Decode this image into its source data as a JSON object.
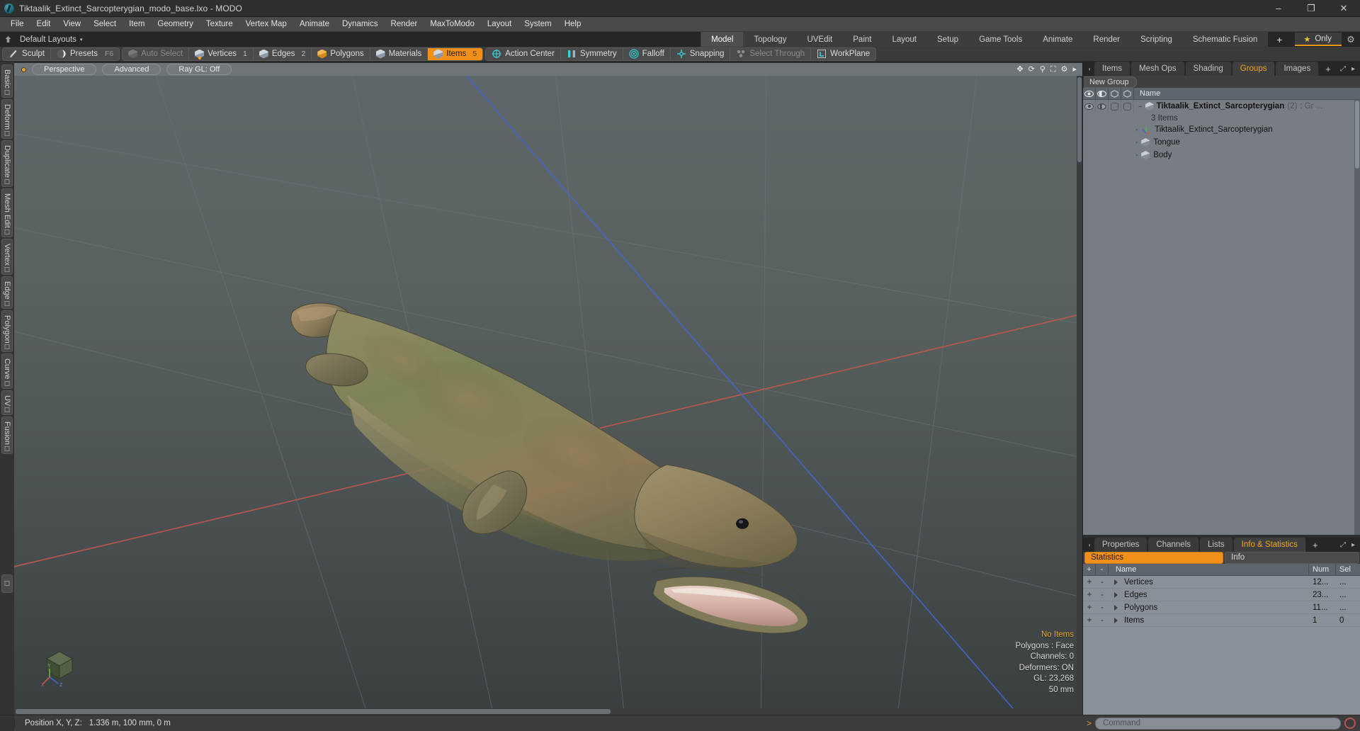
{
  "window": {
    "title": "Tiktaalik_Extinct_Sarcopterygian_modo_base.lxo - MODO",
    "app_icon": "modo-logo-icon",
    "minimize": "–",
    "maximize": "❐",
    "close": "✕"
  },
  "menubar": {
    "items": [
      "File",
      "Edit",
      "View",
      "Select",
      "Item",
      "Geometry",
      "Texture",
      "Vertex Map",
      "Animate",
      "Dynamics",
      "Render",
      "MaxToModo",
      "Layout",
      "System",
      "Help"
    ]
  },
  "layoutbar": {
    "home_icon": "home-arrow-icon",
    "preset_label": "Default Layouts",
    "caret": "▾",
    "tabs": [
      "Model",
      "Topology",
      "UVEdit",
      "Paint",
      "Layout",
      "Setup",
      "Game Tools",
      "Animate",
      "Render",
      "Scripting",
      "Schematic Fusion"
    ],
    "active_tab": "Model",
    "add_tab": "+",
    "only_label": "Only",
    "only_star": "★",
    "gear": "⚙"
  },
  "modebar": {
    "group1": [
      {
        "label": "Sculpt",
        "icon": "brush-icon",
        "state": "normal",
        "shortcut": ""
      },
      {
        "label": "Presets",
        "icon": "sphere-icon",
        "state": "normal",
        "shortcut": "F6"
      }
    ],
    "group2": [
      {
        "label": "Auto Select",
        "icon": "cube-icon",
        "state": "dim",
        "num": ""
      },
      {
        "label": "Vertices",
        "icon": "cube-icon",
        "state": "normal",
        "num": "1"
      },
      {
        "label": "Edges",
        "icon": "cube-icon",
        "state": "normal",
        "num": "2"
      },
      {
        "label": "Polygons",
        "icon": "cube-orange-icon",
        "state": "normal",
        "num": ""
      },
      {
        "label": "Materials",
        "icon": "cube-icon",
        "state": "normal",
        "num": ""
      },
      {
        "label": "Items",
        "icon": "cube-icon",
        "state": "active",
        "num": "5"
      }
    ],
    "group3": [
      {
        "label": "Action Center",
        "icon": "crosshair-circle-icon",
        "state": "normal"
      },
      {
        "label": "Symmetry",
        "icon": "symmetry-bars-icon",
        "state": "normal"
      },
      {
        "label": "Falloff",
        "icon": "concentric-circles-icon",
        "state": "normal"
      },
      {
        "label": "Snapping",
        "icon": "snap-cross-icon",
        "state": "normal"
      },
      {
        "label": "Select Through",
        "icon": "select-through-icon",
        "state": "dim"
      },
      {
        "label": "WorkPlane",
        "icon": "workplane-icon",
        "state": "normal"
      }
    ]
  },
  "left_tool_tabs": [
    "Basic",
    "Deform",
    "Duplicate",
    "Mesh Edit",
    "Vertex",
    "Edge",
    "Polygon",
    "Curve",
    "UV",
    "Fusion"
  ],
  "viewport": {
    "header": {
      "dot": "viewport-active-dot",
      "buttons": [
        "Perspective",
        "Advanced",
        "Ray GL: Off"
      ],
      "icons": [
        "move-icon",
        "rotate-icon",
        "zoom-icon",
        "fit-icon",
        "settings-icon",
        "chevron-right-icon"
      ]
    },
    "overlay": {
      "selection": "No Items",
      "lines": [
        "Polygons : Face",
        "Channels: 0",
        "Deformers: ON",
        "GL: 23,268",
        "50 mm"
      ]
    },
    "axis_labels": {
      "x": "X",
      "y": "Y",
      "z": "Z"
    },
    "model_name": "Tiktaalik 3D fish model"
  },
  "right_panel": {
    "tabs": [
      "Items",
      "Mesh Ops",
      "Shading",
      "Groups",
      "Images"
    ],
    "active_tab": "Groups",
    "add_tab": "+",
    "expand_icon": "expand-icon",
    "overflow_icon": "chevron-right-icon",
    "new_group_label": "New Group",
    "tree_header": {
      "col_icons": [
        "eye-icon",
        "render-eye-icon",
        "wire-cube-icon",
        "wire-cube-icon"
      ],
      "name": "Name"
    },
    "tree": {
      "group": {
        "name": "Tiktaalik_Extinct_Sarcopterygian",
        "count": "(2)",
        "type": ": Gr ...",
        "items_label": "3 Items",
        "icon": "group-cube-icon"
      },
      "children": [
        {
          "name": "Tiktaalik_Extinct_Sarcopterygian",
          "icon": "locator-axis-icon"
        },
        {
          "name": "Tongue",
          "icon": "mesh-cube-icon"
        },
        {
          "name": "Body",
          "icon": "mesh-cube-icon"
        }
      ]
    }
  },
  "bottom_panel": {
    "tabs": [
      "Properties",
      "Channels",
      "Lists",
      "Info & Statistics"
    ],
    "active_tab": "Info & Statistics",
    "add_tab": "+",
    "expand_icon": "expand-icon",
    "overflow_icon": "chevron-right-icon",
    "segments": [
      "Statistics",
      "Info"
    ],
    "active_segment": "Statistics",
    "table": {
      "headers": {
        "plus": "+",
        "minus": "-",
        "name": "Name",
        "num": "Num",
        "sel": "Sel"
      },
      "rows": [
        {
          "plus": "+",
          "minus": "-",
          "name": "Vertices",
          "num": "12...",
          "sel": "..."
        },
        {
          "plus": "+",
          "minus": "-",
          "name": "Edges",
          "num": "23...",
          "sel": "..."
        },
        {
          "plus": "+",
          "minus": "-",
          "name": "Polygons",
          "num": "11...",
          "sel": "..."
        },
        {
          "plus": "+",
          "minus": "-",
          "name": "Items",
          "num": "1",
          "sel": "0"
        }
      ]
    }
  },
  "statusbar": {
    "position_label": "Position X, Y, Z:",
    "position_value": "1.336 m, 100 mm, 0 m",
    "command_chevron": ">",
    "command_placeholder": "Command",
    "record_icon": "record-icon"
  },
  "colors": {
    "accent_orange": "#f0901b",
    "highlight_orange": "#f0a81b",
    "panel_bg": "#2e2e2e",
    "tree_bg": "#777d83",
    "x_axis": "#c95a4e",
    "z_axis": "#4a6fd0"
  }
}
